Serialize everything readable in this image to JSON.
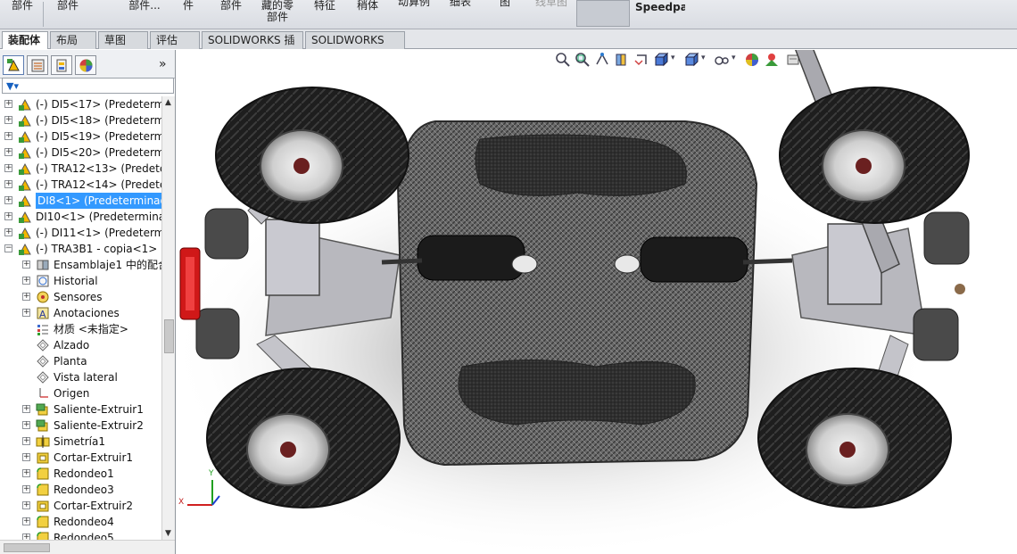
{
  "toolbar": {
    "buttons": [
      {
        "label": "部件"
      },
      {
        "label": "部件"
      },
      {
        "label": "部件..."
      },
      {
        "label": "件"
      },
      {
        "label": "部件"
      },
      {
        "label": "藏的零\n部件"
      },
      {
        "label": "特征"
      },
      {
        "label": "稍体"
      },
      {
        "label": "动算例"
      },
      {
        "label": "细表"
      },
      {
        "label": "图"
      },
      {
        "label": "线草图"
      },
      {
        "label": "Speedpak"
      }
    ]
  },
  "tabs": [
    {
      "label": "装配体"
    },
    {
      "label": "布局"
    },
    {
      "label": "草图"
    },
    {
      "label": "评估"
    },
    {
      "label": "SOLIDWORKS 插件"
    },
    {
      "label": "SOLIDWORKS MBD"
    }
  ],
  "panel": {
    "expand_arrow": "»",
    "filter_icon": "filter-icon"
  },
  "tree": [
    {
      "label": "(-) DI5<17> (Predeterm",
      "icon": "part-icon"
    },
    {
      "label": "(-) DI5<18> (Predeterm",
      "icon": "part-icon"
    },
    {
      "label": "(-) DI5<19> (Predeterm",
      "icon": "part-icon"
    },
    {
      "label": "(-) DI5<20> (Predeterm",
      "icon": "part-icon"
    },
    {
      "label": "(-) TRA12<13> (Predete",
      "icon": "part-icon"
    },
    {
      "label": "(-) TRA12<14> (Predete",
      "icon": "part-icon"
    },
    {
      "label": "DI8<1> (Predeterminad",
      "icon": "part-icon",
      "selected": true
    },
    {
      "label": "DI10<1> (Predetermina",
      "icon": "part-icon"
    },
    {
      "label": "(-) DI11<1> (Predeterm",
      "icon": "part-icon"
    },
    {
      "label": "(-) TRA3B1 - copia<1> (",
      "icon": "part-icon"
    },
    {
      "label": "Ensamblaje1 中的配合",
      "icon": "mates-icon"
    },
    {
      "label": "Historial",
      "icon": "history-icon"
    },
    {
      "label": "Sensores",
      "icon": "sensor-icon"
    },
    {
      "label": "Anotaciones",
      "icon": "annotation-icon"
    },
    {
      "label": "材质 <未指定>",
      "icon": "material-icon"
    },
    {
      "label": "Alzado",
      "icon": "plane-icon"
    },
    {
      "label": "Planta",
      "icon": "plane-icon"
    },
    {
      "label": "Vista lateral",
      "icon": "plane-icon"
    },
    {
      "label": "Origen",
      "icon": "origin-icon"
    },
    {
      "label": "Saliente-Extruir1",
      "icon": "extrude-icon"
    },
    {
      "label": "Saliente-Extruir2",
      "icon": "extrude-icon"
    },
    {
      "label": "Simetría1",
      "icon": "mirror-icon"
    },
    {
      "label": "Cortar-Extruir1",
      "icon": "cut-icon"
    },
    {
      "label": "Redondeo1",
      "icon": "fillet-icon"
    },
    {
      "label": "Redondeo3",
      "icon": "fillet-icon"
    },
    {
      "label": "Cortar-Extruir2",
      "icon": "cut-icon"
    },
    {
      "label": "Redondeo4",
      "icon": "fillet-icon"
    },
    {
      "label": "Redondeo5",
      "icon": "fillet-icon"
    }
  ],
  "triad": {
    "x_label": "X",
    "y_label": "Y"
  }
}
